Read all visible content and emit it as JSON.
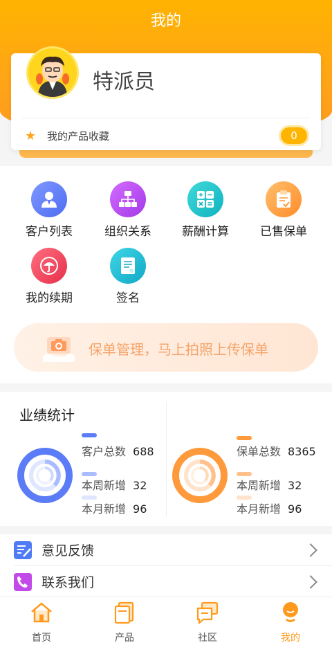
{
  "header": {
    "title": "我的"
  },
  "profile": {
    "name": "特派员",
    "favorites_label": "我的产品收藏",
    "favorites_count": "0"
  },
  "grid": {
    "items": [
      {
        "label": "客户列表",
        "icon": "customer-list-icon",
        "color": "#5b7cf6"
      },
      {
        "label": "组织关系",
        "icon": "org-chart-icon",
        "color": "#b34af0"
      },
      {
        "label": "薪酬计算",
        "icon": "calculator-icon",
        "color": "#18c0c6"
      },
      {
        "label": "已售保单",
        "icon": "clipboard-icon",
        "color": "#ff9a2e"
      },
      {
        "label": "我的续期",
        "icon": "umbrella-icon",
        "color": "#f5455b"
      },
      {
        "label": "签名",
        "icon": "signature-doc-icon",
        "color": "#18b7d0"
      }
    ]
  },
  "banner": {
    "text": "保单管理，马上拍照上传保单"
  },
  "stats": {
    "title": "业绩统计",
    "left": {
      "color": "#5b7cf6",
      "total_label": "客户总数",
      "total_value": "688",
      "week_label": "本周新增",
      "week_value": "32",
      "month_label": "本月新增",
      "month_value": "96"
    },
    "right": {
      "color": "#ff9a3c",
      "total_label": "保单总数",
      "total_value": "8365",
      "week_label": "本周新增",
      "week_value": "32",
      "month_label": "本月新增",
      "month_value": "96"
    }
  },
  "list": {
    "feedback": "意见反馈",
    "contact": "联系我们"
  },
  "tabbar": {
    "tabs": [
      {
        "label": "首页",
        "icon": "home-icon"
      },
      {
        "label": "产品",
        "icon": "product-icon"
      },
      {
        "label": "社区",
        "icon": "community-icon"
      },
      {
        "label": "我的",
        "icon": "profile-icon",
        "active": true
      }
    ]
  }
}
